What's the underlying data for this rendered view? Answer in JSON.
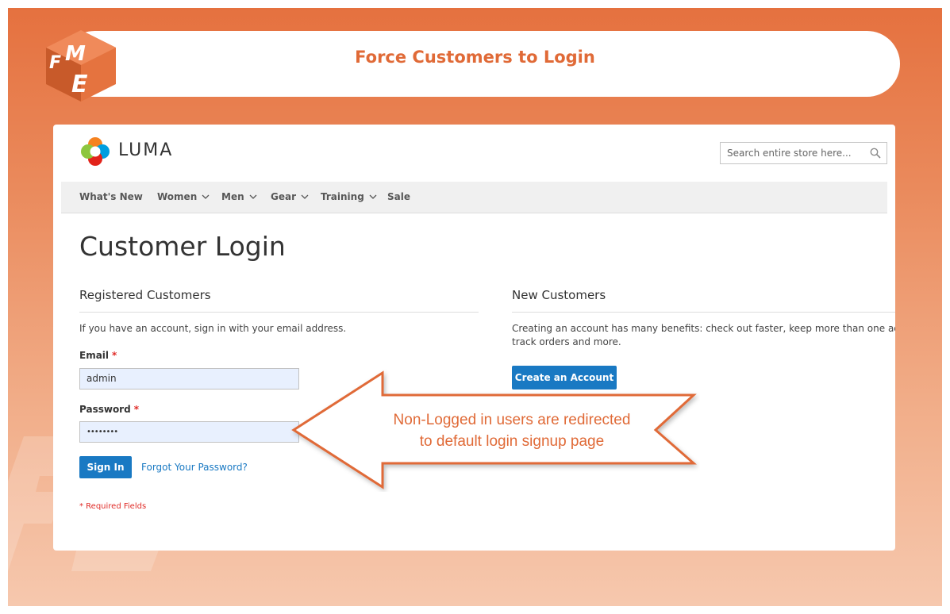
{
  "banner": {
    "title": "Force Customers to Login",
    "logo_text": "FME",
    "accent": "#e06a37"
  },
  "store": {
    "brand": "LUMA",
    "search_placeholder": "Search entire store here...",
    "nav": [
      {
        "label": "What's New",
        "has_menu": false
      },
      {
        "label": "Women",
        "has_menu": true
      },
      {
        "label": "Men",
        "has_menu": true
      },
      {
        "label": "Gear",
        "has_menu": true
      },
      {
        "label": "Training",
        "has_menu": true
      },
      {
        "label": "Sale",
        "has_menu": false
      }
    ]
  },
  "login": {
    "page_title": "Customer Login",
    "registered": {
      "title": "Registered Customers",
      "intro": "If you have an account, sign in with your email address.",
      "email_label": "Email",
      "email_value": "admin",
      "password_label": "Password",
      "password_value": "••••••••",
      "required_mark": "*",
      "sign_in": "Sign In",
      "forgot": "Forgot Your Password?",
      "required_note": "* Required Fields"
    },
    "new_customers": {
      "title": "New Customers",
      "intro_line1": "Creating an account has many benefits: check out faster, keep more than one address,",
      "intro_line2": "track orders and more.",
      "create_button": "Create an Account"
    }
  },
  "callout": {
    "line1": "Non-Logged in users are redirected",
    "line2": "to default login signup page",
    "border_color": "#e06a37"
  }
}
